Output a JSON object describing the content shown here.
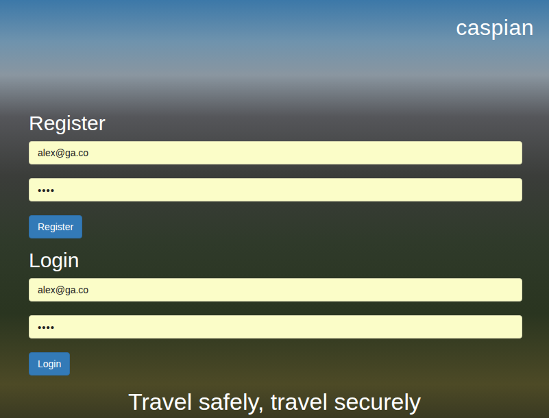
{
  "logo": "caspian",
  "forms": [
    {
      "title": "Register",
      "email": "alex@ga.co",
      "password": "••••",
      "button": "Register"
    },
    {
      "title": "Login",
      "email": "alex@ga.co",
      "password": "••••",
      "button": "Login"
    }
  ],
  "tagline": "Travel safely, travel securely"
}
